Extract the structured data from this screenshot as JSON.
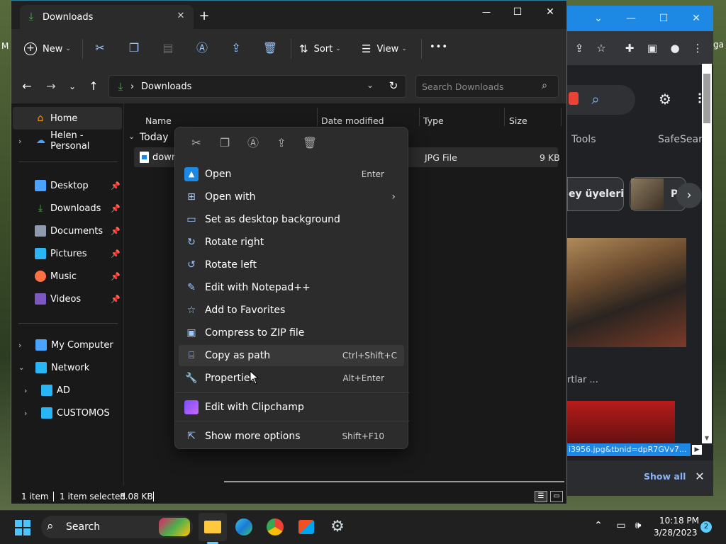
{
  "explorer": {
    "tab_title": "Downloads",
    "new_tab_glyph": "+",
    "window_controls": {
      "minimize": "—",
      "maximize": "☐",
      "close": "✕"
    },
    "toolbar": {
      "new_label": "New",
      "sort_label": "Sort",
      "view_label": "View",
      "more_label": "•••"
    },
    "address": {
      "separator": "›",
      "location": "Downloads",
      "search_placeholder": "Search Downloads"
    },
    "nav": {
      "home": "Home",
      "onedrive": "Helen - Personal",
      "quick": [
        {
          "label": "Desktop",
          "icon": "desktop-icon",
          "color": "#4aa3ff"
        },
        {
          "label": "Downloads",
          "icon": "download-icon",
          "color": "#4caf50"
        },
        {
          "label": "Documents",
          "icon": "documents-icon",
          "color": "#8e9bae"
        },
        {
          "label": "Pictures",
          "icon": "pictures-icon",
          "color": "#29b6f6"
        },
        {
          "label": "Music",
          "icon": "music-icon",
          "color": "#ff7043"
        },
        {
          "label": "Videos",
          "icon": "videos-icon",
          "color": "#7e57c2"
        }
      ],
      "my_computer": "My Computer",
      "network": "Network",
      "network_children": [
        "AD",
        "CUSTOMOS"
      ]
    },
    "columns": {
      "name": "Name",
      "date": "Date modified",
      "type": "Type",
      "size": "Size"
    },
    "group_label": "Today",
    "file": {
      "name": "downl",
      "type": "JPG File",
      "size": "9 KB"
    },
    "status": {
      "items": "1 item",
      "selected": "1 item selected",
      "size": "8.08 KB"
    }
  },
  "context_menu": {
    "items": [
      {
        "label": "Open",
        "shortcut": "Enter",
        "icon": "open-icon"
      },
      {
        "label": "Open with",
        "shortcut": "",
        "icon": "open-with-icon",
        "submenu": true
      },
      {
        "label": "Set as desktop background",
        "shortcut": "",
        "icon": "desktop-background-icon"
      },
      {
        "label": "Rotate right",
        "shortcut": "",
        "icon": "rotate-right-icon"
      },
      {
        "label": "Rotate left",
        "shortcut": "",
        "icon": "rotate-left-icon"
      },
      {
        "label": "Edit with Notepad++",
        "shortcut": "",
        "icon": "notepadpp-icon"
      },
      {
        "label": "Add to Favorites",
        "shortcut": "",
        "icon": "star-icon"
      },
      {
        "label": "Compress to ZIP file",
        "shortcut": "",
        "icon": "zip-icon"
      },
      {
        "label": "Copy as path",
        "shortcut": "Ctrl+Shift+C",
        "icon": "copy-path-icon"
      },
      {
        "label": "Properties",
        "shortcut": "Alt+Enter",
        "icon": "wrench-icon"
      }
    ],
    "clipchamp": "Edit with Clipchamp",
    "more": {
      "label": "Show more options",
      "shortcut": "Shift+F10"
    }
  },
  "browser": {
    "tools": "Tools",
    "safesearch": "SafeSearc",
    "chip_text": "ey üyeleri",
    "chip2_text": "P",
    "caption": "rtlar ...",
    "status_link": "i3956.jpg&tbnid=dpR7GVv7...",
    "show_all": "Show all"
  },
  "desktop": {
    "edge_text": "M",
    "edge_text_right": "ga"
  },
  "taskbar": {
    "search_label": "Search",
    "time": "10:18 PM",
    "date": "3/28/2023",
    "notification_count": "2"
  }
}
